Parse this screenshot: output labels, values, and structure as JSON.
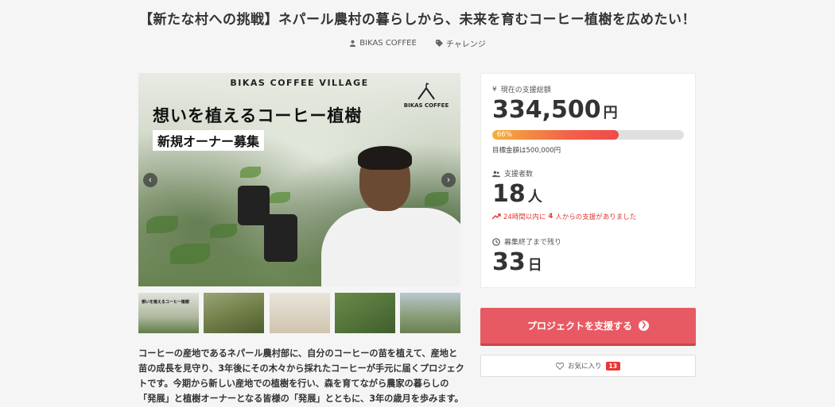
{
  "project": {
    "title": "【新たな村への挑戦】ネパール農村の暮らしから、未来を育むコーヒー植樹を広めたい！",
    "owner": "BIKAS COFFEE",
    "category": "チャレンジ"
  },
  "hero": {
    "brand_line": "BIKAS COFFEE VILLAGE",
    "headline": "想いを植えるコーヒー植樹",
    "subheadline": "新規オーナー募集",
    "logo_text": "BIKAS COFFEE",
    "prev_icon": "chevron-left",
    "next_icon": "chevron-right"
  },
  "thumbnails": [
    {
      "caption": "想いを植えるコーヒー植樹"
    },
    {
      "caption": ""
    },
    {
      "caption": ""
    },
    {
      "caption": ""
    },
    {
      "caption": ""
    }
  ],
  "description": "コーヒーの産地であるネパール農村部に、自分のコーヒーの苗を植えて、産地と苗の成長を見守り、3年後にその木々から採れたコーヒーが手元に届くプロジェクトです。今期から新しい産地での植樹を行い、森を育てながら農家の暮らしの「発展」と植樹オーナーとなる皆様の「発展」とともに、3年の歳月を歩みます。",
  "stats": {
    "total_label": "現在の支援総額",
    "total_value": "334,500",
    "total_unit": "円",
    "progress_percent": 66,
    "progress_text": "66%",
    "target_text": "目標金額は500,000円",
    "supporters_label": "支援者数",
    "supporters_value": "18",
    "supporters_unit": "人",
    "recent_prefix": "24時間以内に",
    "recent_count": "4",
    "recent_suffix": "人からの支援がありました",
    "remaining_label": "募集終了まで残り",
    "remaining_value": "33",
    "remaining_unit": "日"
  },
  "actions": {
    "support_label": "プロジェクトを支援する",
    "favorite_label": "お気に入り",
    "favorite_count": "13"
  },
  "colors": {
    "accent": "#e85a63",
    "alert": "#e53935",
    "background": "#f5f5f5"
  }
}
